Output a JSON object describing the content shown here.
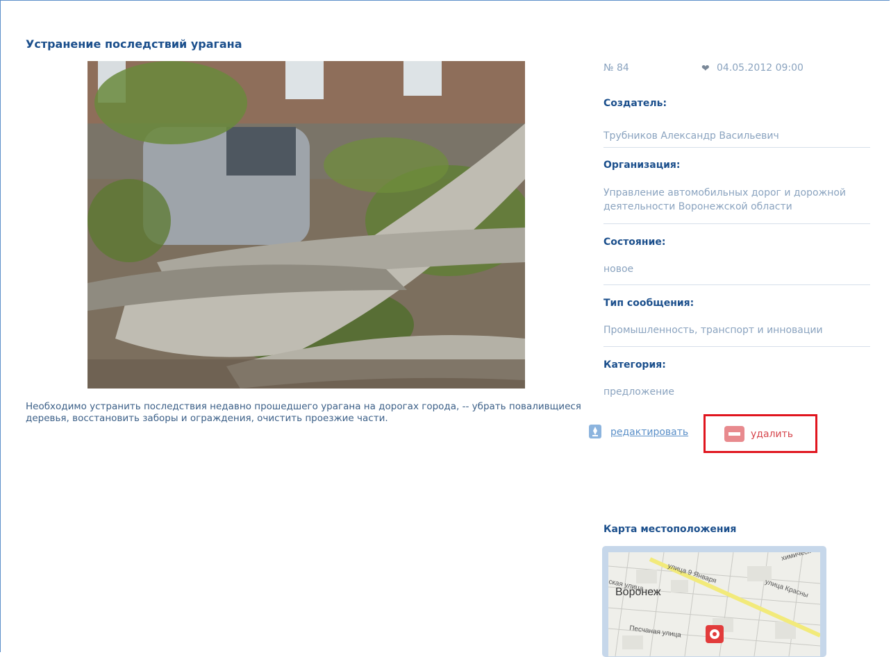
{
  "report": {
    "title": "Устранение последствий урагана",
    "description": "Необходимо устранить последствия недавно прошедшего урагана на дорогах города, -- убрать поваливщиеся деревья, восстановить заборы и ограждения, очистить проезжие части."
  },
  "meta": {
    "number": "№ 84",
    "datetime": "04.05.2012 09:00",
    "creator_label": "Создатель:",
    "creator_value": "Трубников Александр Васильевич",
    "organization_label": "Организация:",
    "organization_value": "Управление автомобильных дорог и дорожной деятельности Воронежской области",
    "state_label": "Состояние:",
    "state_value": "новое",
    "type_label": "Тип сообщения:",
    "type_value": "Промышленность, транспорт и инновации",
    "category_label": "Категория:",
    "category_value": "предложение"
  },
  "actions": {
    "edit_label": "редактировать",
    "delete_label": "удалить"
  },
  "map": {
    "title": "Карта местоположения",
    "labels": {
      "city": "Воронеж",
      "street1": "улица 9 Января",
      "street2": "улица Красны",
      "street3": "ская улица",
      "street4": "Песчаная улица",
      "street5": "химическ"
    }
  },
  "colors": {
    "heading": "#1b4f8c",
    "value_text": "#8aa3bf",
    "highlight_box": "#e0151e"
  }
}
